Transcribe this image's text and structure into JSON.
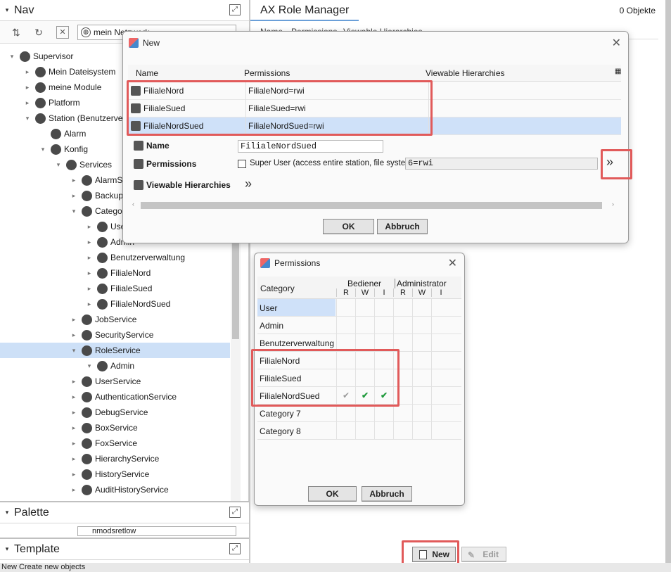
{
  "nav": {
    "title": "Nav",
    "combo_text": "mein Netzwerk",
    "tree": [
      {
        "label": "Supervisor",
        "depth": 0,
        "arrow": "▾",
        "icon": "supervisor-icon"
      },
      {
        "label": "Mein Dateisystem",
        "depth": 1,
        "arrow": "▸",
        "icon": "filesystem-icon"
      },
      {
        "label": "meine Module",
        "depth": 1,
        "arrow": "▸",
        "icon": "modules-icon"
      },
      {
        "label": "Platform",
        "depth": 1,
        "arrow": "▸",
        "icon": "platform-icon"
      },
      {
        "label": "Station (Benutzerverwaltung)",
        "depth": 1,
        "arrow": "▾",
        "icon": "station-icon"
      },
      {
        "label": "Alarm",
        "depth": 2,
        "arrow": "",
        "icon": "alarm-icon"
      },
      {
        "label": "Konfig",
        "depth": 2,
        "arrow": "▾",
        "icon": "config-icon"
      },
      {
        "label": "Services",
        "depth": 3,
        "arrow": "▾",
        "icon": "services-icon"
      },
      {
        "label": "AlarmService",
        "depth": 4,
        "arrow": "▸",
        "icon": "alarm-service-icon"
      },
      {
        "label": "BackupService",
        "depth": 4,
        "arrow": "▸",
        "icon": "backup-icon"
      },
      {
        "label": "CategoryService",
        "depth": 4,
        "arrow": "▾",
        "icon": "category-icon"
      },
      {
        "label": "User",
        "depth": 5,
        "arrow": "▸",
        "icon": "category-item-icon"
      },
      {
        "label": "Admin",
        "depth": 5,
        "arrow": "▸",
        "icon": "category-item-icon"
      },
      {
        "label": "Benutzerverwaltung",
        "depth": 5,
        "arrow": "▸",
        "icon": "category-item-icon"
      },
      {
        "label": "FilialeNord",
        "depth": 5,
        "arrow": "▸",
        "icon": "category-item-icon"
      },
      {
        "label": "FilialeSued",
        "depth": 5,
        "arrow": "▸",
        "icon": "category-item-icon"
      },
      {
        "label": "FilialeNordSued",
        "depth": 5,
        "arrow": "▸",
        "icon": "category-item-icon"
      },
      {
        "label": "JobService",
        "depth": 4,
        "arrow": "▸",
        "icon": "job-icon"
      },
      {
        "label": "SecurityService",
        "depth": 4,
        "arrow": "▸",
        "icon": "security-icon"
      },
      {
        "label": "RoleService",
        "depth": 4,
        "arrow": "▾",
        "icon": "role-icon",
        "selected": true
      },
      {
        "label": "Admin",
        "depth": 5,
        "arrow": "▾",
        "icon": "role-item-icon"
      },
      {
        "label": "UserService",
        "depth": 4,
        "arrow": "▸",
        "icon": "user-service-icon"
      },
      {
        "label": "AuthenticationService",
        "depth": 4,
        "arrow": "▸",
        "icon": "auth-icon"
      },
      {
        "label": "DebugService",
        "depth": 4,
        "arrow": "▸",
        "icon": "debug-icon"
      },
      {
        "label": "BoxService",
        "depth": 4,
        "arrow": "▸",
        "icon": "box-icon"
      },
      {
        "label": "FoxService",
        "depth": 4,
        "arrow": "▸",
        "icon": "fox-icon"
      },
      {
        "label": "HierarchyService",
        "depth": 4,
        "arrow": "▸",
        "icon": "hierarchy-icon"
      },
      {
        "label": "HistoryService",
        "depth": 4,
        "arrow": "▸",
        "icon": "history-icon"
      },
      {
        "label": "AuditHistoryService",
        "depth": 4,
        "arrow": "▸",
        "icon": "audit-icon"
      }
    ]
  },
  "palette": {
    "title": "Palette",
    "combo_text": "nmodsretlow"
  },
  "template": {
    "title": "Template"
  },
  "main": {
    "tab": "AX Role Manager",
    "count": "0 Objekte",
    "columns": [
      "Name",
      "Permissions",
      "Viewable Hierarchies"
    ],
    "new_label": "New",
    "edit_label": "Edit"
  },
  "new_dialog": {
    "title": "New",
    "columns": [
      "Name",
      "Permissions",
      "Viewable Hierarchies"
    ],
    "rows": [
      {
        "name": "FilialeNord",
        "perm": "FilialeNord=rwi"
      },
      {
        "name": "FilialeSued",
        "perm": "FilialeSued=rwi"
      },
      {
        "name": "FilialeNordSued",
        "perm": "FilialeNordSued=rwi",
        "selected": true
      }
    ],
    "name_label": "Name",
    "name_value": "FilialeNordSued",
    "permissions_label": "Permissions",
    "super_user_label": "Super User (access entire station, file system)",
    "perm_value": "6=rwi",
    "hierarchies_label": "Viewable Hierarchies",
    "ok": "OK",
    "cancel": "Abbruch"
  },
  "perm_dialog": {
    "title": "Permissions",
    "category_header": "Category",
    "groups": [
      "Bediener",
      "Administrator"
    ],
    "subcols": [
      "R",
      "W",
      "I",
      "R",
      "W",
      "I"
    ],
    "rows": [
      {
        "cat": "User",
        "marks": [
          "",
          "",
          "",
          "",
          "",
          ""
        ],
        "selected": true
      },
      {
        "cat": "Admin",
        "marks": [
          "",
          "",
          "",
          "",
          "",
          ""
        ]
      },
      {
        "cat": "Benutzerverwaltung",
        "marks": [
          "",
          "",
          "",
          "",
          "",
          ""
        ]
      },
      {
        "cat": "FilialeNord",
        "marks": [
          "",
          "",
          "",
          "",
          "",
          ""
        ]
      },
      {
        "cat": "FilialeSued",
        "marks": [
          "",
          "",
          "",
          "",
          "",
          ""
        ]
      },
      {
        "cat": "FilialeNordSued",
        "marks": [
          "✔",
          "✔",
          "✔",
          "",
          "",
          ""
        ]
      },
      {
        "cat": "Category 7",
        "marks": [
          "",
          "",
          "",
          "",
          "",
          ""
        ]
      },
      {
        "cat": "Category 8",
        "marks": [
          "",
          "",
          "",
          "",
          "",
          ""
        ]
      }
    ],
    "ok": "OK",
    "cancel": "Abbruch"
  },
  "status_text": "New Create new objects",
  "colors": {
    "highlight": "#e15a5a",
    "selection": "#cfe1f9",
    "check": "#1f9a3c"
  }
}
